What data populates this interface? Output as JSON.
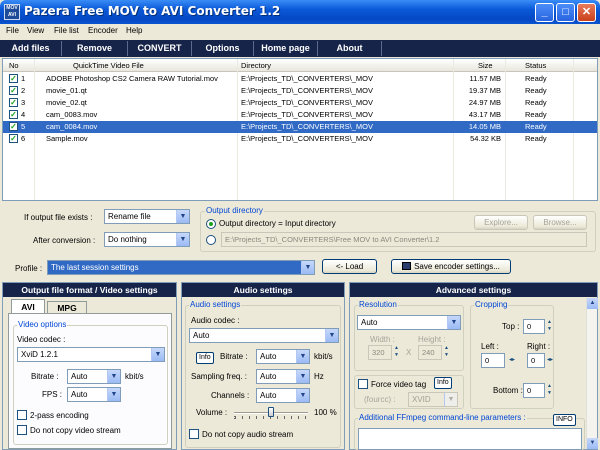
{
  "window": {
    "title": "Pazera Free MOV to AVI Converter 1.2",
    "icon_text": "MOV AVI"
  },
  "menu": [
    "File",
    "View",
    "File list",
    "Encoder",
    "Help"
  ],
  "toolbar": [
    "Add files",
    "Remove",
    "CONVERT",
    "Options",
    "Home page",
    "About"
  ],
  "list": {
    "columns": [
      "No",
      "QuickTime Video File",
      "Directory",
      "Size",
      "Status"
    ],
    "rows": [
      {
        "no": "1",
        "file": "ADOBE Photoshop CS2 Camera RAW Tutorial.mov",
        "dir": "E:\\Projects_TD\\_CONVERTERS\\_MOV",
        "size": "11.57 MB",
        "status": "Ready"
      },
      {
        "no": "2",
        "file": "movie_01.qt",
        "dir": "E:\\Projects_TD\\_CONVERTERS\\_MOV",
        "size": "19.37 MB",
        "status": "Ready"
      },
      {
        "no": "3",
        "file": "movie_02.qt",
        "dir": "E:\\Projects_TD\\_CONVERTERS\\_MOV",
        "size": "24.97 MB",
        "status": "Ready"
      },
      {
        "no": "4",
        "file": "cam_0083.mov",
        "dir": "E:\\Projects_TD\\_CONVERTERS\\_MOV",
        "size": "43.17 MB",
        "status": "Ready"
      },
      {
        "no": "5",
        "file": "cam_0084.mov",
        "dir": "E:\\Projects_TD\\_CONVERTERS\\_MOV",
        "size": "14.05 MB",
        "status": "Ready"
      },
      {
        "no": "6",
        "file": "Sample.mov",
        "dir": "E:\\Projects_TD\\_CONVERTERS\\_MOV",
        "size": "54.32 KB",
        "status": "Ready"
      }
    ],
    "selected_index": 4
  },
  "options": {
    "if_exists_label": "If output file exists :",
    "if_exists_value": "Rename file",
    "after_label": "After conversion :",
    "after_value": "Do nothing",
    "outdir_title": "Output directory",
    "outdir_same_label": "Output directory = Input directory",
    "outdir_path": "E:\\Projects_TD\\_CONVERTERS\\Free MOV to AVI Converter\\1.2",
    "explore": "Explore...",
    "browse": "Browse..."
  },
  "profile": {
    "label": "Profile :",
    "value": "The last session settings",
    "load": "<- Load",
    "save": "Save encoder settings..."
  },
  "video": {
    "header": "Output file format / Video settings",
    "tab_avi": "AVI",
    "tab_mpg": "MPG",
    "group": "Video options",
    "codec_label": "Video codec :",
    "codec_value": "XviD 1.2.1",
    "bitrate_label": "Bitrate :",
    "bitrate_value": "Auto",
    "bitrate_unit": "kbit/s",
    "fps_label": "FPS :",
    "fps_value": "Auto",
    "twopass": "2-pass encoding",
    "nocopy": "Do not copy video stream"
  },
  "audio": {
    "header": "Audio settings",
    "group": "Audio settings",
    "codec_label": "Audio codec :",
    "codec_value": "Auto",
    "info": "Info",
    "bitrate_label": "Bitrate :",
    "bitrate_value": "Auto",
    "bitrate_unit": "kbit/s",
    "freq_label": "Sampling freq. :",
    "freq_value": "Auto",
    "freq_unit": "Hz",
    "channels_label": "Channels :",
    "channels_value": "Auto",
    "volume_label": "Volume :",
    "volume_value": "100 %",
    "volume_level": 0.5,
    "nocopy": "Do not copy audio stream"
  },
  "advanced": {
    "header": "Advanced settings",
    "res_group": "Resolution",
    "res_value": "Auto",
    "width_label": "Width :",
    "width_value": "320",
    "height_label": "Height :",
    "height_value": "240",
    "x": "X",
    "force_tag": "Force video tag",
    "info": "Info",
    "fourcc_label": "(fourcc) :",
    "fourcc_value": "XVID",
    "crop_group": "Cropping",
    "top_label": "Top :",
    "top_value": "0",
    "left_label": "Left :",
    "left_value": "0",
    "right_label": "Right :",
    "right_value": "0",
    "bottom_label": "Bottom :",
    "bottom_value": "0",
    "ffmpeg_label": "Additional FFmpeg command-line parameters :",
    "ffmpeg_info": "INFO"
  },
  "colors": {
    "toolbar": "#16244a",
    "selection": "#316ac5",
    "titlebar": "#0a58d8",
    "group_label": "#0046d5"
  }
}
